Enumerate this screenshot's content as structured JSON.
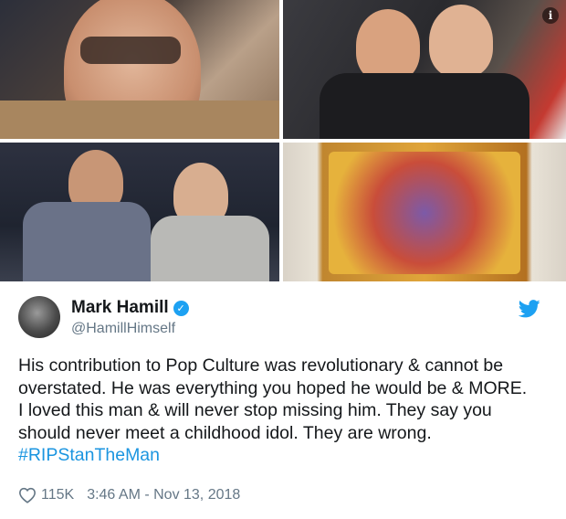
{
  "tweet": {
    "name": "Mark Hamill",
    "handle": "@HamillHimself",
    "verified_icon": "verified-badge-icon",
    "brand_icon": "twitter-bird-icon",
    "text_lines": [
      "His contribution to Pop Culture was revolutionary & cannot be",
      "overstated. He was everything you hoped he would be & MORE.",
      "I loved this man & will never stop missing him. They say you",
      "should never meet a childhood idol. They are wrong."
    ],
    "hashtag": "#RIPStanTheMan",
    "likes": "115K",
    "timestamp": "3:46 AM - Nov 13, 2018"
  },
  "media": {
    "images": [
      "stan-lee-portrait",
      "hamill-and-stan-lee-event",
      "hamill-and-stan-lee-interview",
      "comic-artwork"
    ],
    "info_label": "i"
  },
  "colors": {
    "accent": "#1da1f2",
    "link": "#1b95e0",
    "secondary_text": "#657786"
  }
}
